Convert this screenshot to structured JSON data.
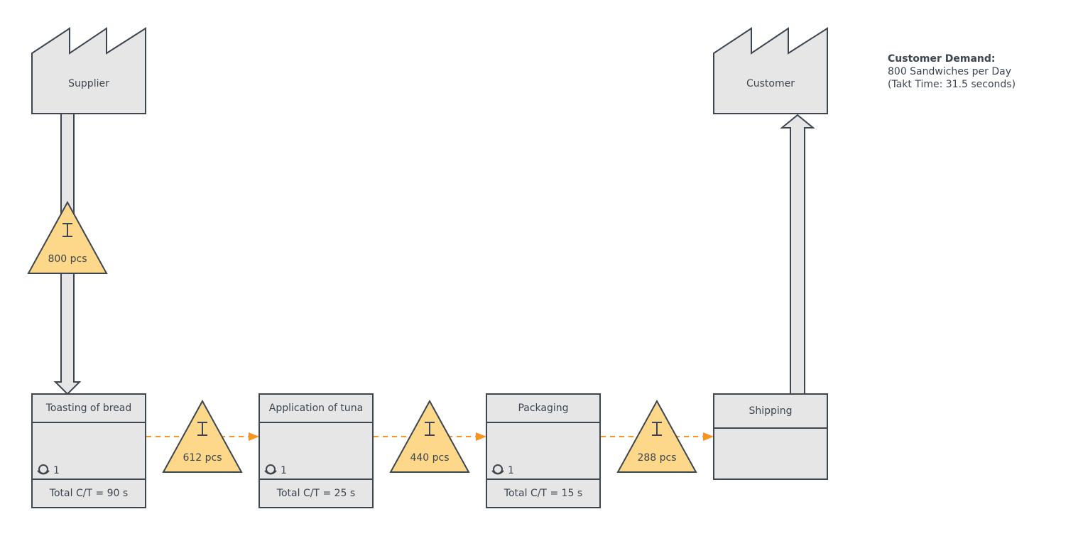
{
  "supplier": {
    "label": "Supplier",
    "icon": "factory-icon"
  },
  "customer": {
    "label": "Customer",
    "icon": "factory-icon"
  },
  "customer_demand": {
    "title": "Customer Demand:",
    "line1": "800 Sandwiches per Day",
    "line2": "(Takt Time: 31.5 seconds)"
  },
  "supplier_inventory": {
    "label": "800 pcs"
  },
  "processes": [
    {
      "name": "Toasting of bread",
      "operators": "1",
      "cycle_time": "Total C/T = 90 s"
    },
    {
      "name": "Application of tuna",
      "operators": "1",
      "cycle_time": "Total C/T = 25 s"
    },
    {
      "name": "Packaging",
      "operators": "1",
      "cycle_time": "Total C/T = 15 s"
    }
  ],
  "shipping": {
    "name": "Shipping"
  },
  "inventories": [
    {
      "label": "612 pcs"
    },
    {
      "label": "440 pcs"
    },
    {
      "label": "288 pcs"
    }
  ],
  "colors": {
    "stroke": "#3c4650",
    "fill": "#e6e6e6",
    "inventory": "#fdd88a",
    "push_arrow": "#f7931e"
  }
}
